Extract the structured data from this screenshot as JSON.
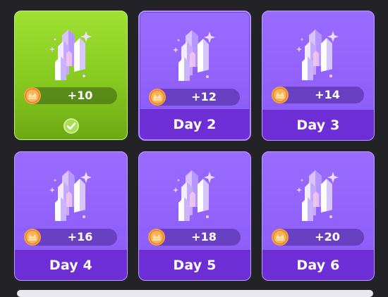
{
  "rewards": [
    {
      "reward": "+10",
      "day": "",
      "status": "claimed"
    },
    {
      "reward": "+12",
      "day": "Day 2",
      "status": "selected"
    },
    {
      "reward": "+14",
      "day": "Day 3",
      "status": "locked"
    },
    {
      "reward": "+16",
      "day": "Day 4",
      "status": "locked"
    },
    {
      "reward": "+18",
      "day": "Day 5",
      "status": "locked"
    },
    {
      "reward": "+20",
      "day": "Day 6",
      "status": "locked"
    }
  ],
  "icons": {
    "reward_item": "crystal-icon",
    "currency": "coin-icon",
    "claimed": "check-icon"
  },
  "colors": {
    "background": "#232327",
    "claimed_card": "#9fe233",
    "card": "#9a6bff",
    "footer": "#6d2ed6",
    "coin": "#f7a043"
  }
}
